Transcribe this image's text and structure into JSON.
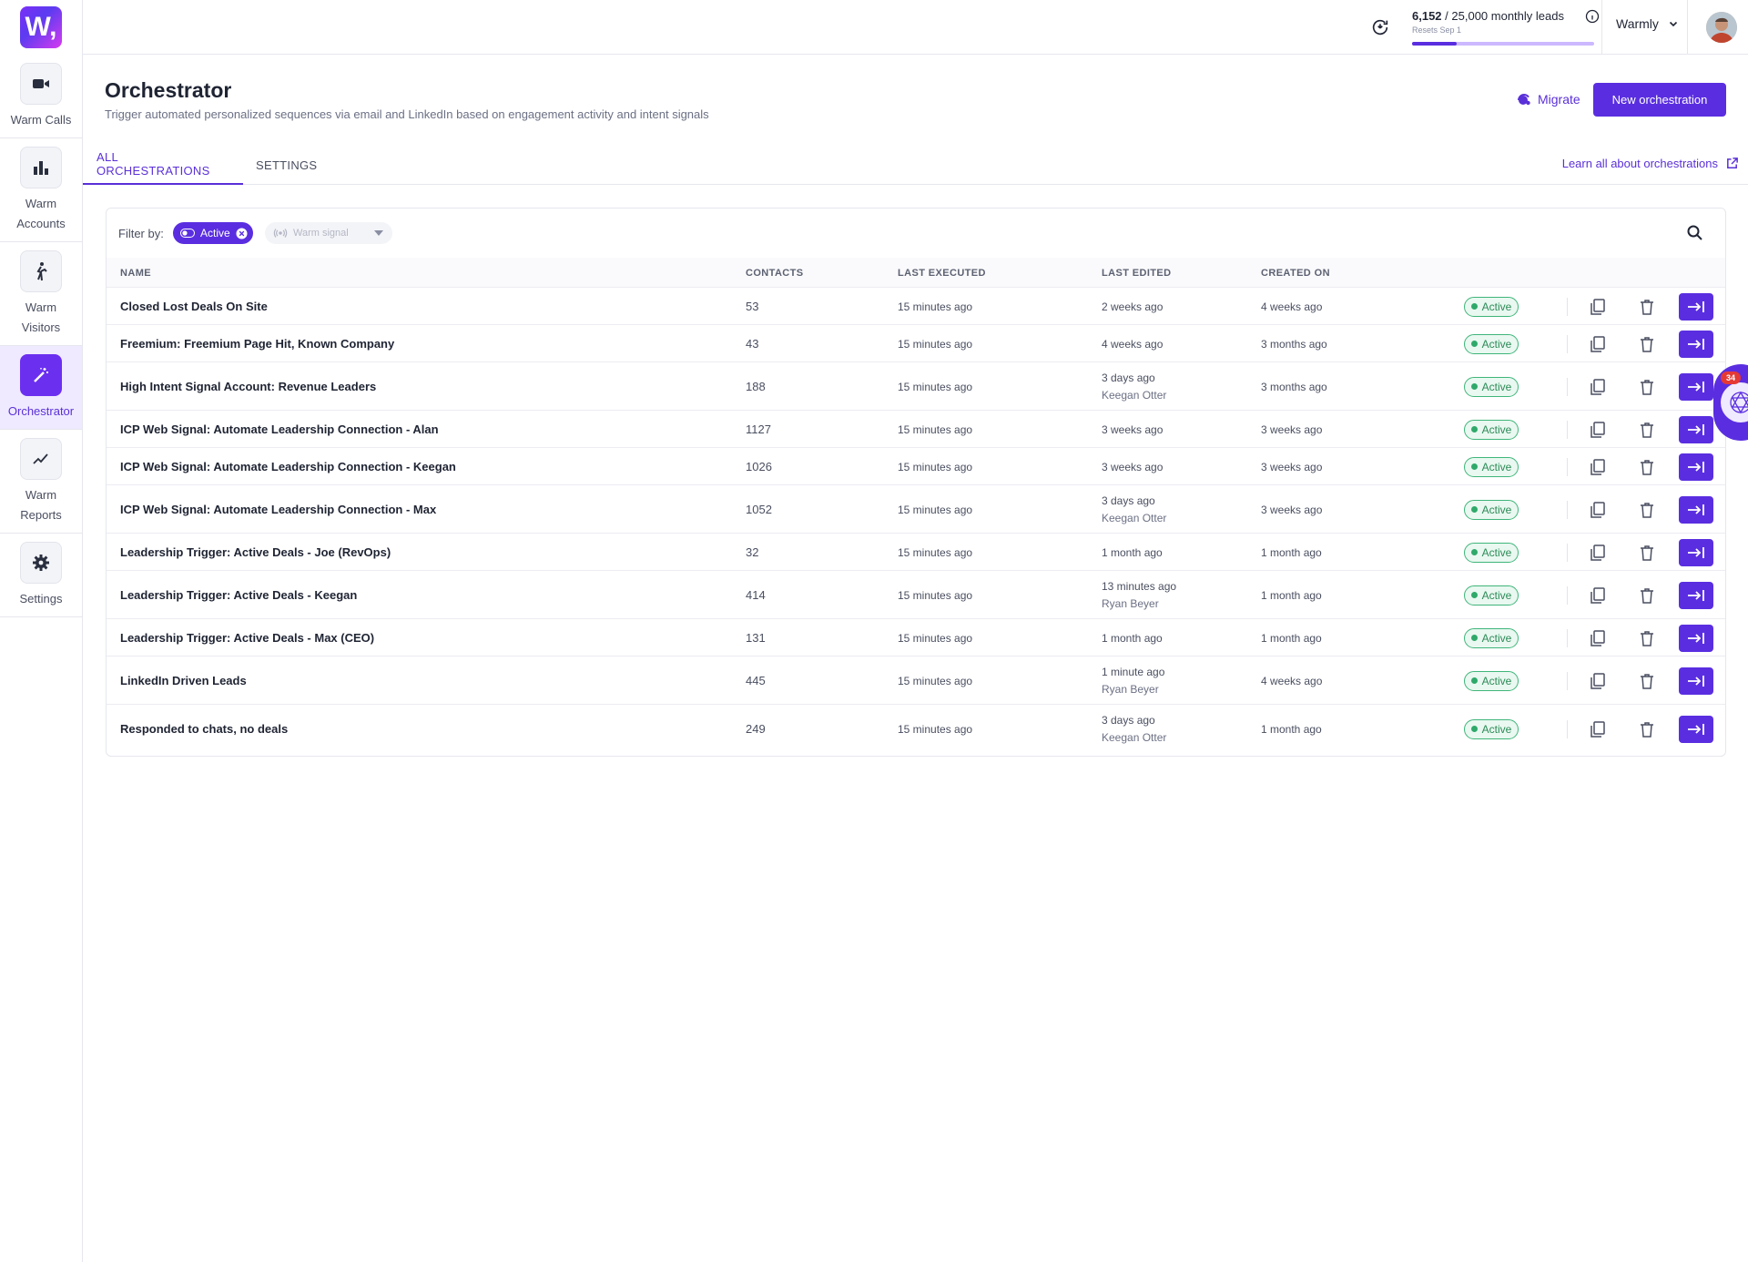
{
  "app": {
    "logo_text": "W,",
    "brand_color": "#5a2ee0"
  },
  "sidebar": {
    "items": [
      {
        "label": "Warm Calls",
        "icon": "video-camera-icon",
        "active": false
      },
      {
        "label": "Warm Accounts",
        "icon": "bar-chart-icon",
        "active": false
      },
      {
        "label": "Warm Visitors",
        "icon": "walking-person-icon",
        "active": false
      },
      {
        "label": "Orchestrator",
        "icon": "magic-wand-icon",
        "active": true
      },
      {
        "label": "Warm Reports",
        "icon": "trend-line-icon",
        "active": false
      },
      {
        "label": "Settings",
        "icon": "gear-icon",
        "active": false
      }
    ]
  },
  "topbar": {
    "leads_used": "6,152",
    "leads_total": "/ 25,000 monthly leads",
    "resets": "Resets Sep 1",
    "usage_fraction": 0.246,
    "workspace": "Warmly"
  },
  "header": {
    "title": "Orchestrator",
    "subtitle": "Trigger automated personalized sequences via email and LinkedIn based on engagement activity and intent signals",
    "migrate_label": "Migrate",
    "new_button_label": "New orchestration"
  },
  "tabs": {
    "items": [
      "ALL ORCHESTRATIONS",
      "SETTINGS"
    ],
    "active_index": 0,
    "learn_link": "Learn all about orchestrations"
  },
  "filters": {
    "label": "Filter by:",
    "active_chip": "Active",
    "signal_placeholder": "Warm signal"
  },
  "table": {
    "columns": [
      "NAME",
      "CONTACTS",
      "LAST EXECUTED",
      "LAST EDITED",
      "CREATED ON"
    ],
    "rows": [
      {
        "name": "Closed Lost Deals On Site",
        "contacts": "53",
        "last_executed": "15 minutes ago",
        "last_edited": "2 weeks ago",
        "edited_by": "",
        "created_on": "4 weeks ago",
        "status": "Active"
      },
      {
        "name": "Freemium: Freemium Page Hit, Known Company",
        "contacts": "43",
        "last_executed": "15 minutes ago",
        "last_edited": "4 weeks ago",
        "edited_by": "",
        "created_on": "3 months ago",
        "status": "Active"
      },
      {
        "name": "High Intent Signal Account: Revenue Leaders",
        "contacts": "188",
        "last_executed": "15 minutes ago",
        "last_edited": "3 days ago",
        "edited_by": "Keegan Otter",
        "created_on": "3 months ago",
        "status": "Active"
      },
      {
        "name": "ICP Web Signal: Automate Leadership Connection - Alan",
        "contacts": "1127",
        "last_executed": "15 minutes ago",
        "last_edited": "3 weeks ago",
        "edited_by": "",
        "created_on": "3 weeks ago",
        "status": "Active"
      },
      {
        "name": "ICP Web Signal: Automate Leadership Connection - Keegan",
        "contacts": "1026",
        "last_executed": "15 minutes ago",
        "last_edited": "3 weeks ago",
        "edited_by": "",
        "created_on": "3 weeks ago",
        "status": "Active"
      },
      {
        "name": "ICP Web Signal: Automate Leadership Connection - Max",
        "contacts": "1052",
        "last_executed": "15 minutes ago",
        "last_edited": "3 days ago",
        "edited_by": "Keegan Otter",
        "created_on": "3 weeks ago",
        "status": "Active"
      },
      {
        "name": "Leadership Trigger: Active Deals - Joe (RevOps)",
        "contacts": "32",
        "last_executed": "15 minutes ago",
        "last_edited": "1 month ago",
        "edited_by": "",
        "created_on": "1 month ago",
        "status": "Active"
      },
      {
        "name": "Leadership Trigger: Active Deals - Keegan",
        "contacts": "414",
        "last_executed": "15 minutes ago",
        "last_edited": "13 minutes ago",
        "edited_by": "Ryan Beyer",
        "created_on": "1 month ago",
        "status": "Active"
      },
      {
        "name": "Leadership Trigger: Active Deals - Max (CEO)",
        "contacts": "131",
        "last_executed": "15 minutes ago",
        "last_edited": "1 month ago",
        "edited_by": "",
        "created_on": "1 month ago",
        "status": "Active"
      },
      {
        "name": "LinkedIn Driven Leads",
        "contacts": "445",
        "last_executed": "15 minutes ago",
        "last_edited": "1 minute ago",
        "edited_by": "Ryan Beyer",
        "created_on": "4 weeks ago",
        "status": "Active"
      },
      {
        "name": "Responded to chats, no deals",
        "contacts": "249",
        "last_executed": "15 minutes ago",
        "last_edited": "3 days ago",
        "edited_by": "Keegan Otter",
        "created_on": "1 month ago",
        "status": "Active"
      }
    ]
  },
  "widget": {
    "notification_count": "34"
  }
}
